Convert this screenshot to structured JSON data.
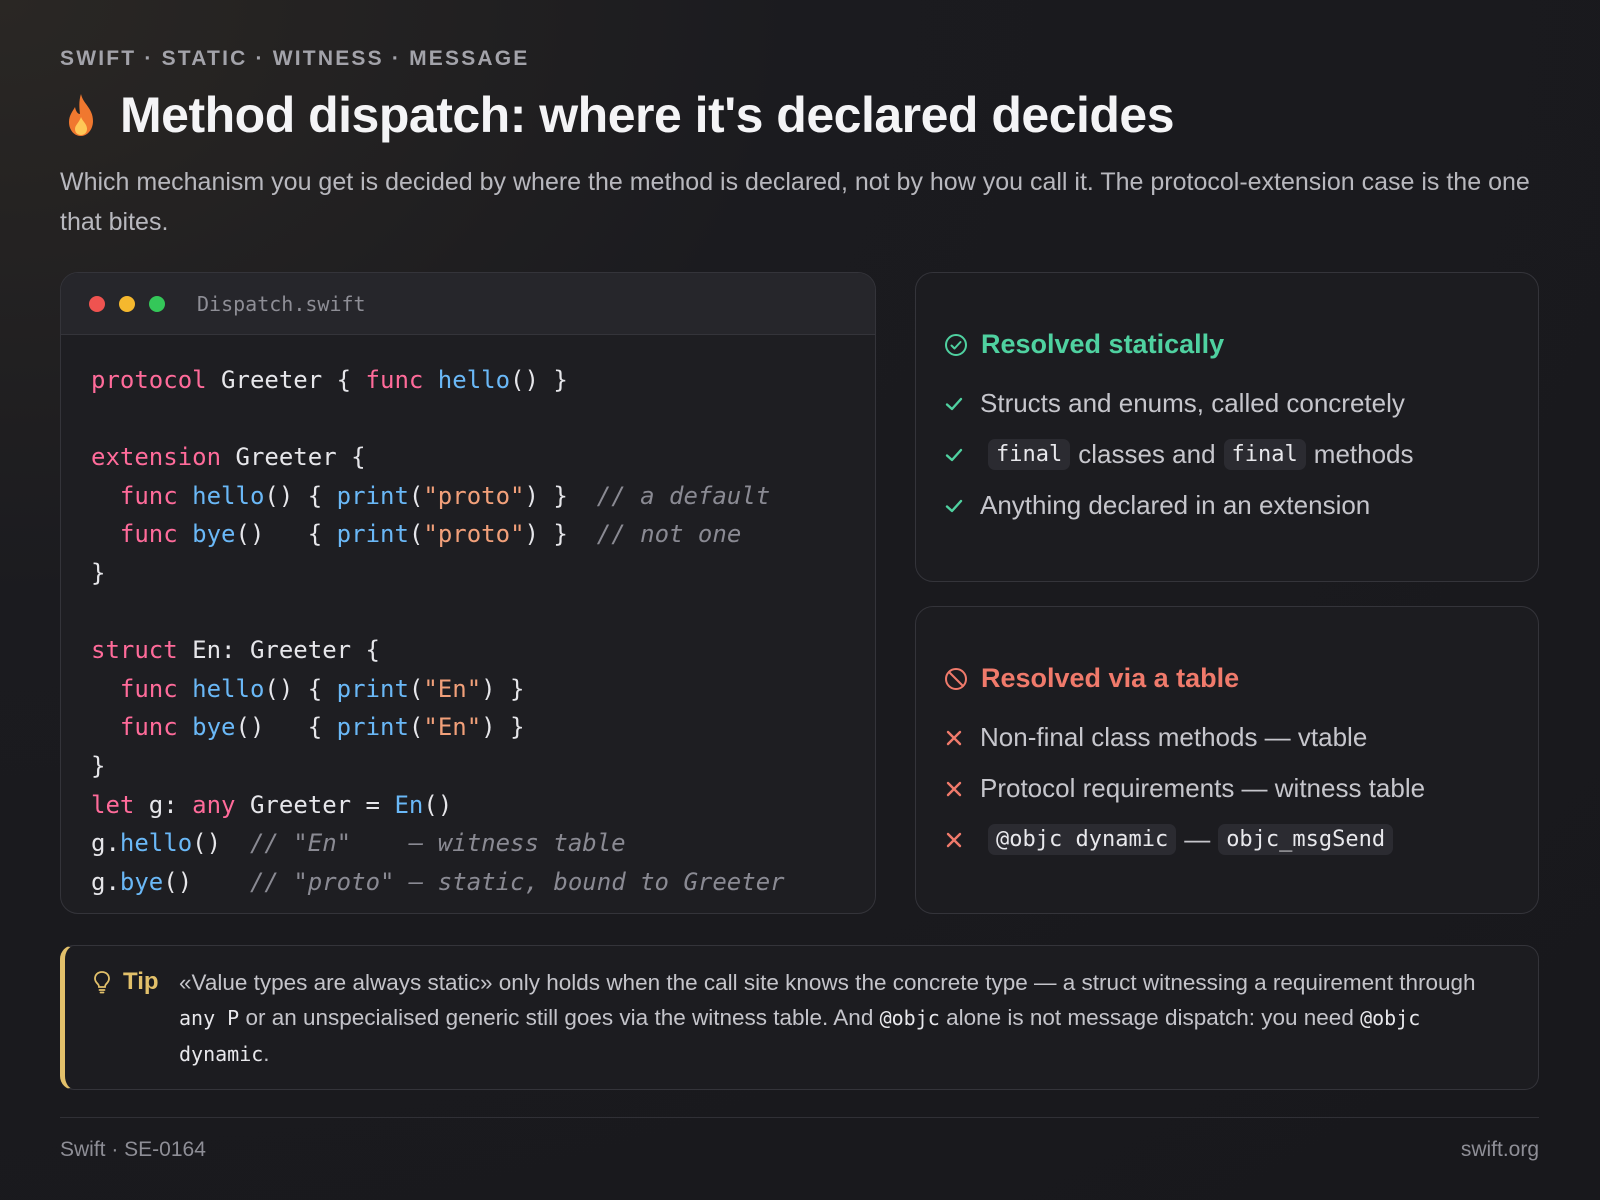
{
  "header": {
    "eyebrow": "SWIFT · STATIC · WITNESS · MESSAGE",
    "title": "Method dispatch: where it's declared decides",
    "subtitle": "Which mechanism you get is decided by where the method is declared, not by how you call it. The protocol-extension case is the one that bites.",
    "icon": "flame-icon"
  },
  "code_card": {
    "filename": "Dispatch.swift",
    "window_buttons": [
      "close",
      "minimize",
      "zoom"
    ]
  },
  "static_card": {
    "title": "Resolved statically",
    "items": {
      "i0": "Structs and enums, called concretely",
      "i1_code1": "final",
      "i1_text1": "classes and",
      "i1_code2": "final",
      "i1_text2": "methods",
      "i2": "Anything declared in an extension"
    },
    "accent": "#4fd1a0"
  },
  "table_card": {
    "title": "Resolved via a table",
    "items": {
      "i0": "Non-final class methods — vtable",
      "i1": "Protocol requirements — witness table",
      "i2_code1": "@objc dynamic",
      "i2_sep": "—",
      "i2_code2": "objc_msgSend"
    },
    "accent": "#f07a6b"
  },
  "tip": {
    "label": "Tip",
    "t1": "«Value types are always static» only holds when the call site knows the concrete type — a struct witnessing a requirement through ",
    "c1": "any P",
    "t2": " or an unspecialised generic still goes via the witness table. And ",
    "c2": "@objc",
    "t3": " alone is not message dispatch: you need ",
    "c3": "@objc dynamic",
    "t4": ".",
    "accent": "#e2c06a"
  },
  "footer": {
    "left": "Swift · SE-0164",
    "right": "swift.org"
  }
}
